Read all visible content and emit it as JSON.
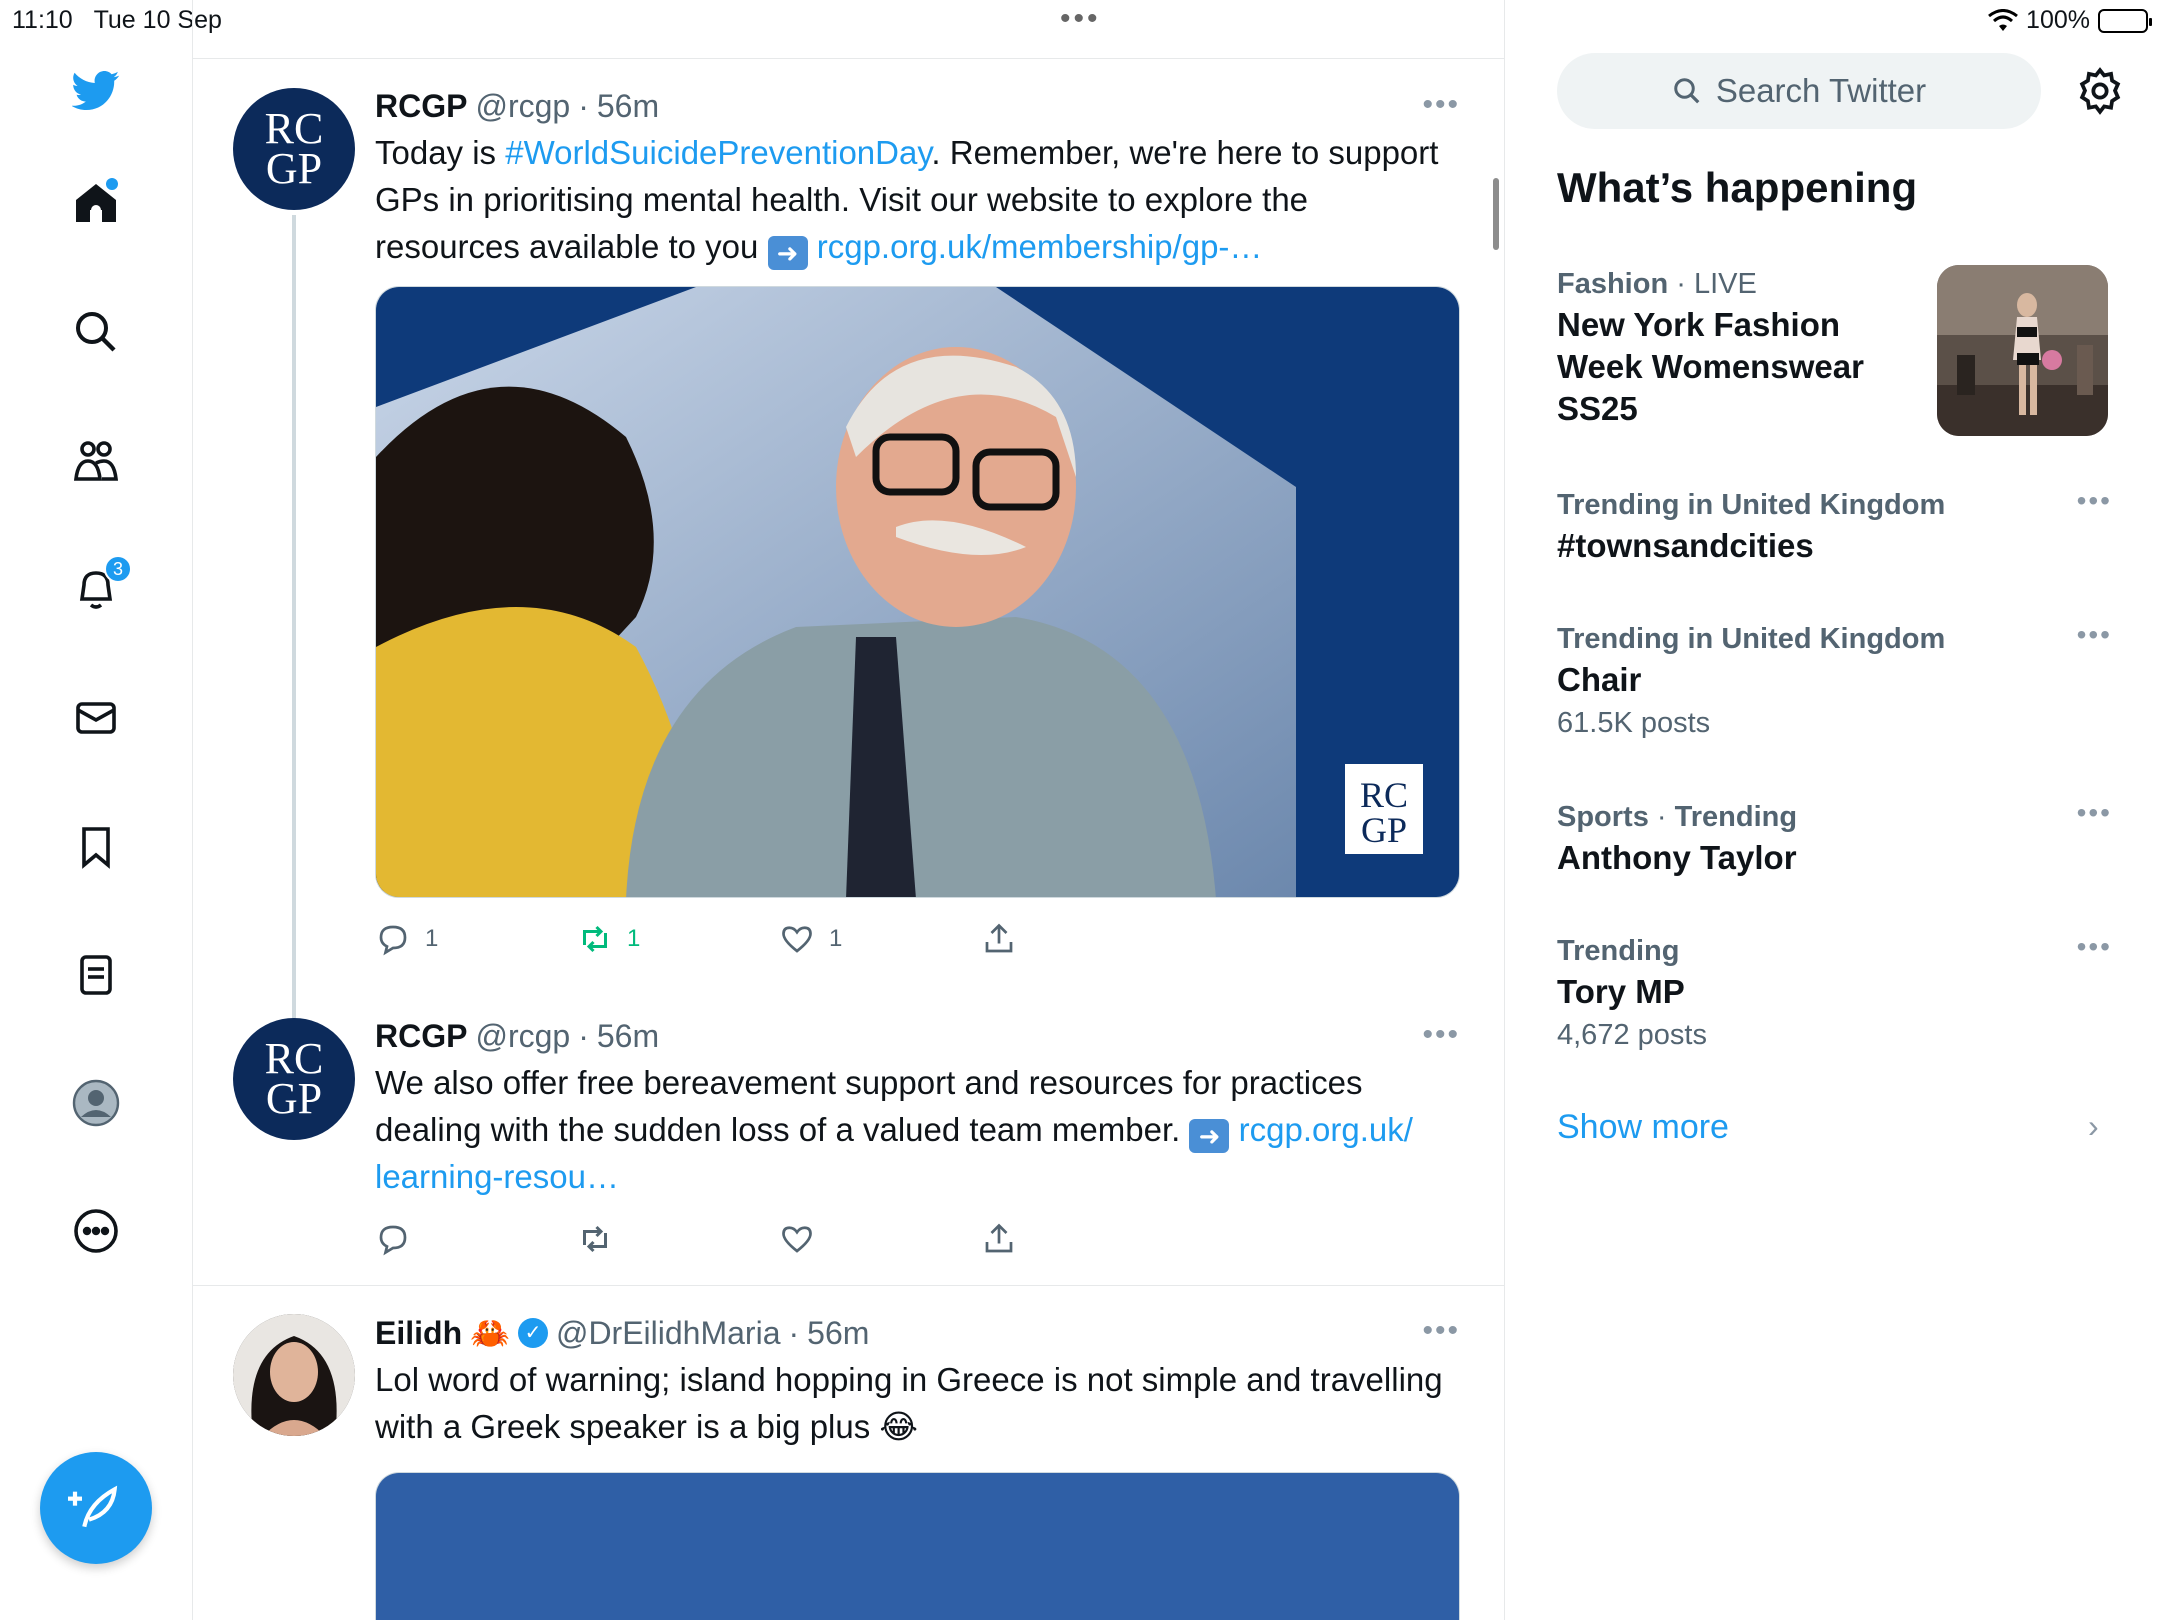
{
  "status_bar": {
    "time": "11:10",
    "date": "Tue 10 Sep",
    "battery": "100%",
    "dots": "•••"
  },
  "nav": {
    "items": [
      "twitter-logo",
      "home-icon",
      "search-icon",
      "communities-icon",
      "notifications-icon",
      "messages-icon",
      "bookmarks-icon",
      "lists-icon",
      "profile-icon",
      "more-icon"
    ],
    "notification_count": "3"
  },
  "feed": {
    "tweets": [
      {
        "name": "RCGP",
        "handle": "@rcgp",
        "time": "56m",
        "text_parts": [
          "Today is ",
          "#WorldSuicidePreventionDay",
          ". Remember, we're here to support GPs in prioritising mental health. Visit our website to explore the resources available to you ",
          "rcgp.org.uk/membership/gp-…"
        ],
        "media_logo": [
          "RC",
          "GP"
        ],
        "replies": "1",
        "retweets": "1",
        "likes": "1"
      },
      {
        "name": "RCGP",
        "handle": "@rcgp",
        "time": "56m",
        "text_parts": [
          "We also offer free bereavement support and resources for practices dealing with the sudden loss of a valued team member. ",
          "rcgp.org.uk/",
          "learning-resou…"
        ]
      },
      {
        "name": "Eilidh",
        "handle": "@DrEilidhMaria",
        "time": "56m",
        "text": "Lol  word of warning; island hopping in Greece is not simple and travelling with a Greek speaker is a big plus 😂"
      }
    ],
    "avatar_logo": [
      "RC",
      "GP"
    ],
    "sep": "·",
    "more": "•••"
  },
  "right": {
    "search_placeholder": "Search Twitter",
    "title": "What’s happening",
    "trends": [
      {
        "category": "Fashion",
        "qualifier": "LIVE",
        "name": "New York Fashion Week Womenswear SS25"
      },
      {
        "category": "Trending in United Kingdom",
        "name": "#townsandcities"
      },
      {
        "category": "Trending in United Kingdom",
        "name": "Chair",
        "count": "61.5K posts"
      },
      {
        "category": "Sports",
        "qualifier": "Trending",
        "name": "Anthony Taylor"
      },
      {
        "category": "Trending",
        "name": "Tory MP",
        "count": "4,672 posts"
      }
    ],
    "show_more": "Show more",
    "chevron": "›"
  },
  "colors": {
    "accent": "#1d9bf0",
    "rcgp_navy": "#0c2a5a",
    "retweet_green": "#00ba7c"
  }
}
